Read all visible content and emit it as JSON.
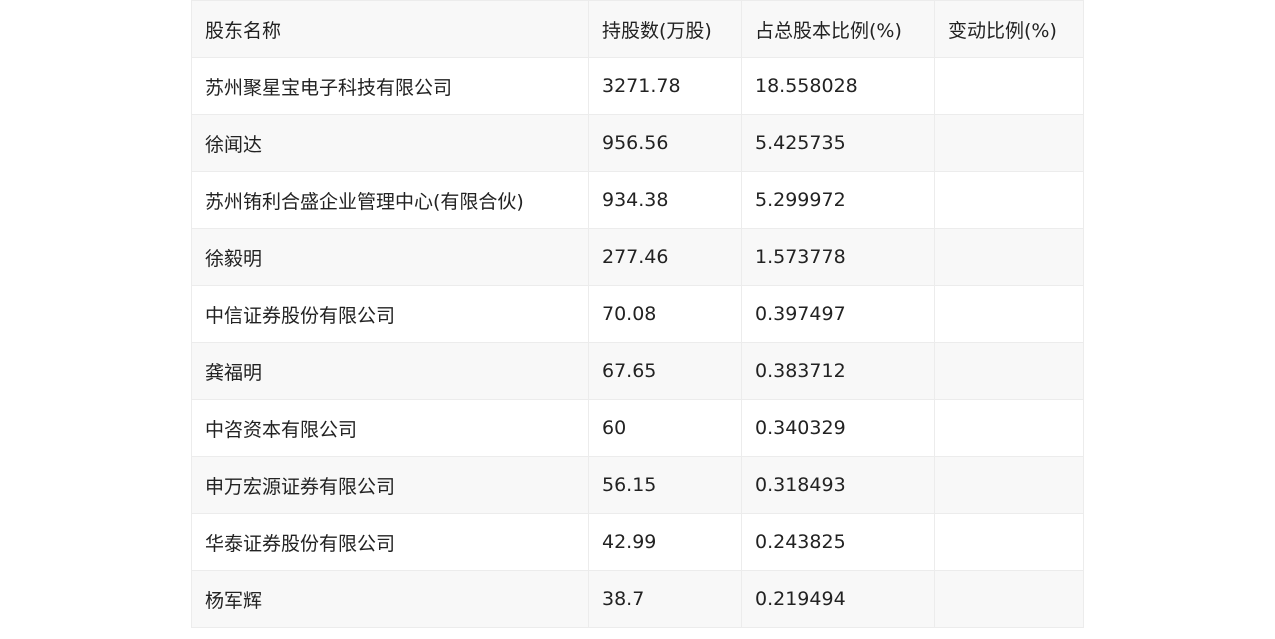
{
  "table": {
    "headers": [
      "股东名称",
      "持股数(万股)",
      "占总股本比例(%)",
      "变动比例(%)"
    ],
    "rows": [
      [
        "苏州聚星宝电子科技有限公司",
        "3271.78",
        "18.558028",
        ""
      ],
      [
        "徐闻达",
        "956.56",
        "5.425735",
        ""
      ],
      [
        "苏州铕利合盛企业管理中心(有限合伙)",
        "934.38",
        "5.299972",
        ""
      ],
      [
        "徐毅明",
        "277.46",
        "1.573778",
        ""
      ],
      [
        "中信证券股份有限公司",
        "70.08",
        "0.397497",
        ""
      ],
      [
        "龚福明",
        "67.65",
        "0.383712",
        ""
      ],
      [
        "中咨资本有限公司",
        "60",
        "0.340329",
        ""
      ],
      [
        "申万宏源证券有限公司",
        "56.15",
        "0.318493",
        ""
      ],
      [
        "华泰证券股份有限公司",
        "42.99",
        "0.243825",
        ""
      ],
      [
        "杨军辉",
        "38.7",
        "0.219494",
        ""
      ]
    ]
  }
}
